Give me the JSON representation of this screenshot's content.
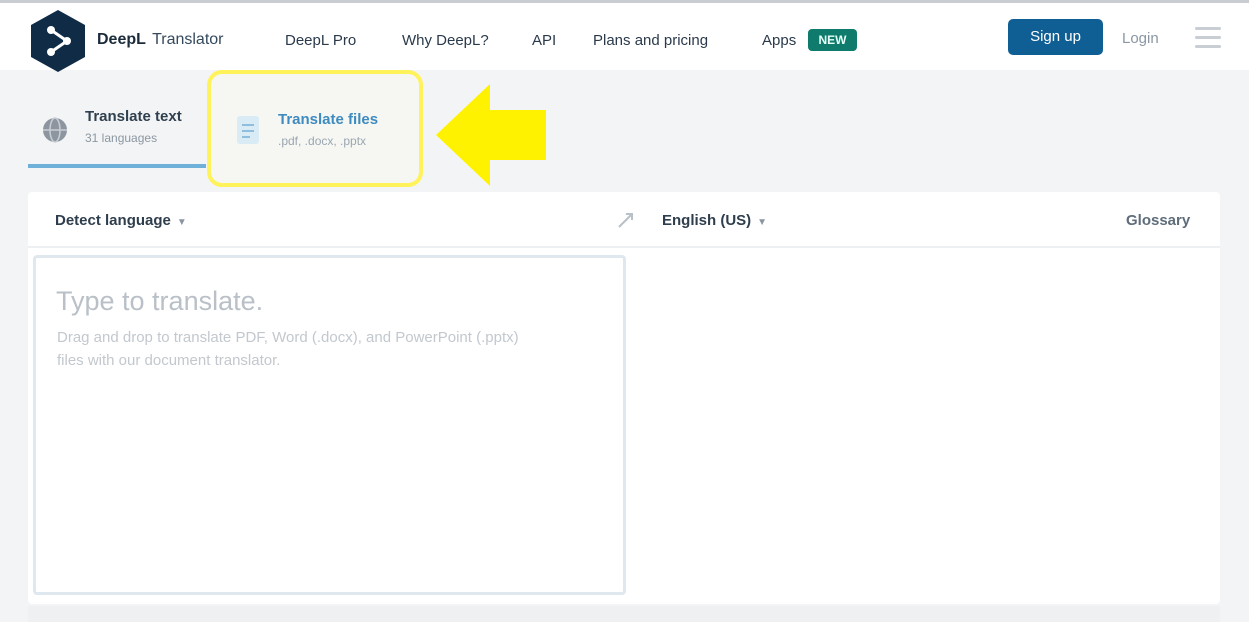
{
  "header": {
    "brand": "DeepL",
    "brand_sub": "Translator",
    "nav": [
      "DeepL Pro",
      "Why DeepL?",
      "API",
      "Plans and pricing",
      "Apps"
    ],
    "apps_badge": "NEW",
    "signup_label": "Sign up",
    "login_label": "Login"
  },
  "tabs": {
    "text": {
      "title": "Translate text",
      "subtitle": "31 languages"
    },
    "files": {
      "title": "Translate files",
      "subtitle": ".pdf, .docx, .pptx"
    }
  },
  "translator": {
    "source_lang": "Detect language",
    "target_lang": "English (US)",
    "glossary_label": "Glossary",
    "placeholder": "Type to translate.",
    "hint": "Drag and drop to translate PDF, Word (.docx), and PowerPoint (.pptx) files with our document translator."
  },
  "colors": {
    "brand_dark": "#0f2b46",
    "signup_blue": "#0f5f95",
    "badge_green": "#0f7b6c",
    "highlight_yellow": "#fff25a",
    "arrow_yellow": "#fff200"
  },
  "icons": [
    "deepl-logo-icon",
    "globe-icon",
    "document-icon",
    "swap-icon",
    "chevron-down-icon",
    "menu-icon",
    "arrow-pointer-icon"
  ]
}
